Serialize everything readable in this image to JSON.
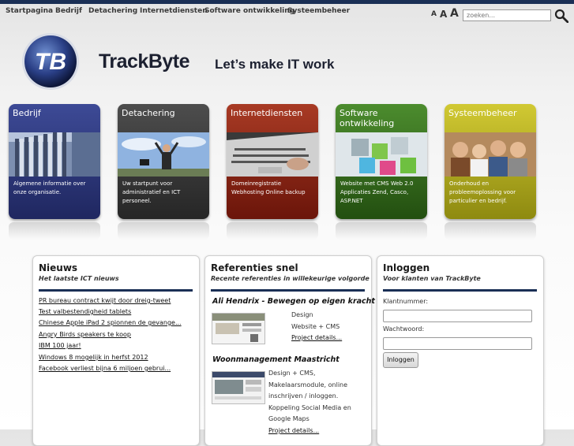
{
  "topnav": {
    "items": [
      "Startpagina",
      "Bedrijf",
      "Detachering",
      "Internetdiensten",
      "Software ontwikkeling",
      "Systeembeheer"
    ],
    "font_size_labels": [
      "A",
      "A",
      "A"
    ],
    "search_placeholder": "zoeken..."
  },
  "header": {
    "logo_text": "TB",
    "brand": "TrackByte",
    "tagline": "Let’s make IT work"
  },
  "tiles": [
    {
      "title": "Bedrijf",
      "desc": "Algemene informatie over onze organisatie.",
      "color": "#2b3577",
      "icon": "office-building-photo"
    },
    {
      "title": "Detachering",
      "desc": "Uw startpunt voor administratief en ICT personeel.",
      "color": "#333333",
      "icon": "businessman-sky-photo"
    },
    {
      "title": "Internetdiensten",
      "desc": "Domeinregistratie Webhosting Online backup",
      "color": "#8c2414",
      "icon": "laptop-keyboard-photo"
    },
    {
      "title": "Software ontwikkeling",
      "desc": "Website met CMS Web 2.0 Applicaties Zend, Casco, ASP.NET",
      "color": "#356f1f",
      "icon": "cubes-photo"
    },
    {
      "title": "Systeembeheer",
      "desc": "Onderhoud en probleemoplossing voor particulier en bedrijf.",
      "color": "#b8b118",
      "icon": "team-photo"
    }
  ],
  "news": {
    "title": "Nieuws",
    "subtitle": "Het laatste ICT nieuws",
    "items": [
      "PR bureau contract kwijt door dreig-tweet",
      "Test valbestendigheid tablets",
      "Chinese Apple iPad 2 spionnen de gevange...",
      "Angry Birds speakers te koop",
      "IBM 100 jaar!",
      "Windows 8 mogelijk in herfst 2012",
      "Facebook verliest bijna 6 miljoen gebrui..."
    ]
  },
  "references": {
    "title": "Referenties snel",
    "subtitle": "Recente referenties in willekeurige volgorde",
    "entries": [
      {
        "name": "Ali Hendrix - Bewegen op eigen kracht",
        "lines": [
          "Design",
          "Website + CMS"
        ],
        "link": "Project details..."
      },
      {
        "name": "Woonmanagement Maastricht",
        "lines": [
          "Design + CMS,",
          "Makelaarsmodule, online",
          "inschrijven / inloggen.",
          "Koppeling Social Media en",
          "Google Maps"
        ],
        "link": "Project details..."
      }
    ]
  },
  "login": {
    "title": "Inloggen",
    "subtitle": "Voor klanten van TrackByte",
    "customer_label": "Klantnummer:",
    "password_label": "Wachtwoord:",
    "button": "Inloggen"
  }
}
